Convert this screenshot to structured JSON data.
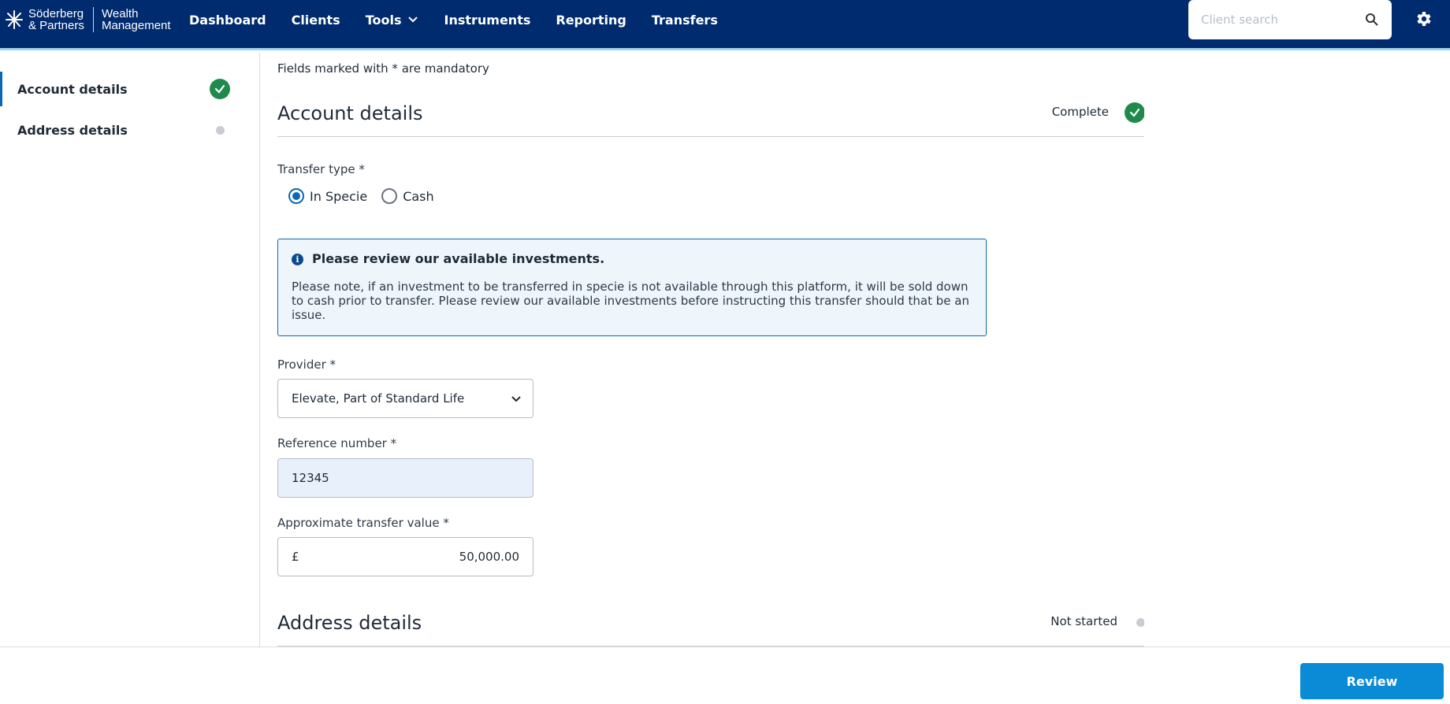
{
  "header": {
    "logo": {
      "brand_line1": "Söderberg",
      "brand_line2": "& Partners",
      "product_line1": "Wealth",
      "product_line2": "Management"
    },
    "nav": [
      {
        "label": "Dashboard"
      },
      {
        "label": "Clients"
      },
      {
        "label": "Tools",
        "has_dropdown": true
      },
      {
        "label": "Instruments"
      },
      {
        "label": "Reporting"
      },
      {
        "label": "Transfers"
      }
    ],
    "search": {
      "placeholder": "Client search",
      "value": "",
      "icon": "search-icon"
    },
    "settings_icon": "gear-icon"
  },
  "sidebar": {
    "items": [
      {
        "label": "Account details",
        "status": "complete",
        "active": true
      },
      {
        "label": "Address details",
        "status": "not-started",
        "active": false
      }
    ]
  },
  "main": {
    "mandatory_note": "Fields marked with * are mandatory",
    "account_section": {
      "title": "Account details",
      "status": "Complete"
    },
    "transfer_type": {
      "label": "Transfer type *",
      "options": [
        "In Specie",
        "Cash"
      ],
      "selected": "In Specie"
    },
    "info_box": {
      "title": "Please review our available investments.",
      "body": "Please note, if an investment to be transferred in specie is not available through this platform, it will be sold down to cash prior to transfer. Please review our available investments before instructing this transfer should that be an issue."
    },
    "provider": {
      "label": "Provider *",
      "value": "Elevate, Part of Standard Life"
    },
    "reference": {
      "label": "Reference number *",
      "value": "12345"
    },
    "transfer_value": {
      "label": "Approximate transfer value *",
      "currency": "£",
      "value": "50,000.00"
    },
    "address_section": {
      "title": "Address details",
      "status": "Not started"
    }
  },
  "footer": {
    "review_label": "Review"
  },
  "colors": {
    "header_bg": "#002b6e",
    "accent": "#0b68b4",
    "success": "#1f8a4c",
    "button": "#0b8ad6"
  }
}
